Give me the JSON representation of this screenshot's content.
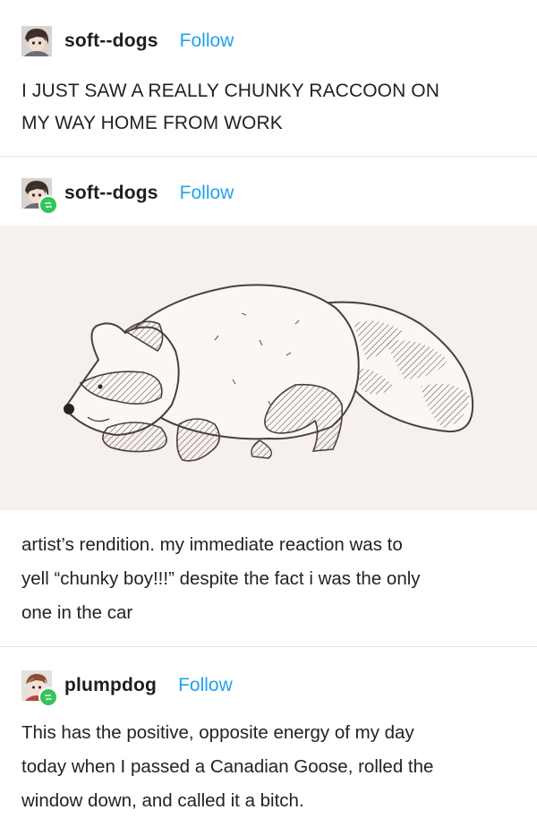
{
  "posts": [
    {
      "username": "soft--dogs",
      "follow_label": "Follow",
      "text_lines": [
        "I JUST SAW A REALLY CHUNKY RACCOON ON",
        "MY WAY HOME FROM WORK"
      ]
    },
    {
      "username": "soft--dogs",
      "follow_label": "Follow",
      "reblog": true,
      "image_description": "raccoon-drawing",
      "text_lines": [
        "artist’s rendition. my immediate reaction was to",
        "yell “chunky boy!!!” despite the fact i was the only",
        "one in the car"
      ]
    },
    {
      "username": "plumpdog",
      "follow_label": "Follow",
      "reblog": true,
      "text_lines": [
        "This has the positive, opposite energy of my day",
        "today when I passed a Canadian Goose, rolled the",
        "window down, and called it a bitch."
      ]
    }
  ],
  "colors": {
    "follow": "#1fa3ea",
    "reblog_badge": "#35c45b",
    "art_background": "#f6f1ed"
  }
}
